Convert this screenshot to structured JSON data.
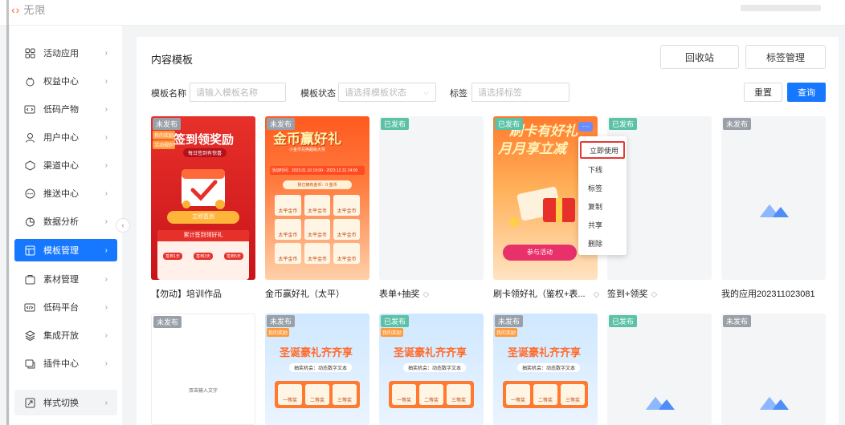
{
  "brand": {
    "mark": "‹›",
    "name": "无限"
  },
  "sidebar": {
    "items": [
      {
        "label": "活动应用",
        "icon": "apps-grid-icon"
      },
      {
        "label": "权益中心",
        "icon": "gift-icon"
      },
      {
        "label": "低码产物",
        "icon": "code-box-icon"
      },
      {
        "label": "用户中心",
        "icon": "user-icon"
      },
      {
        "label": "渠道中心",
        "icon": "channel-icon"
      },
      {
        "label": "推送中心",
        "icon": "push-icon"
      },
      {
        "label": "数据分析",
        "icon": "pie-chart-icon"
      },
      {
        "label": "模板管理",
        "icon": "template-icon",
        "active": true
      },
      {
        "label": "素材管理",
        "icon": "material-icon"
      },
      {
        "label": "低码平台",
        "icon": "lowcode-icon"
      },
      {
        "label": "集成开放",
        "icon": "layers-icon"
      },
      {
        "label": "插件中心",
        "icon": "plugin-icon"
      }
    ],
    "style_switch": "样式切换"
  },
  "main": {
    "title": "内容模板",
    "recycle_bin": "回收站",
    "tag_manage": "标签管理",
    "filters": {
      "name_label": "模板名称",
      "name_placeholder": "请输入模板名称",
      "status_label": "模板状态",
      "status_placeholder": "请选择模板状态",
      "tag_label": "标签",
      "tag_placeholder": "请选择标签",
      "reset": "重置",
      "query": "查询"
    }
  },
  "cards": [
    {
      "badge": "未发布",
      "name": "【勿动】培训作品",
      "poster": {
        "title": "签到领奖励",
        "subtitle": "每日签到有惊喜",
        "corner1": "我的奖励",
        "corner2": "活动规则",
        "button": "立即签到",
        "section": "累计签到领好礼",
        "steps": [
          "签到1天",
          "签到3天",
          "签到5天"
        ]
      }
    },
    {
      "badge": "未发布",
      "name": "金币赢好礼（太平）",
      "poster": {
        "title": "金币赢好礼",
        "subtitle": "小金币兑换超级大奖",
        "time": "活动时间：2023.01.10 10:00 - 2023.12.31 24:00",
        "coins": "我已拥有金币：0 金币",
        "cell": "太平金币"
      }
    },
    {
      "badge": "已发布",
      "name": "表单+抽奖",
      "tag": true
    },
    {
      "badge": "已发布",
      "name": "刷卡领好礼（鉴权+表...",
      "tag": true,
      "poster": {
        "title1": "刷卡有好礼",
        "title2": "月月享立减",
        "button": "参与活动"
      }
    },
    {
      "badge": "已发布",
      "name": "签到+领奖",
      "tag": true
    },
    {
      "badge": "未发布",
      "name": "我的应用202311023081"
    },
    {
      "badge": "未发布",
      "text": "双击输入文字"
    },
    {
      "badge": "未发布",
      "corner": "我的奖励",
      "poster": {
        "title": "圣诞豪礼齐齐享",
        "sub": "抽奖机会：动态数字文本",
        "cells": [
          "一等奖",
          "二等奖",
          "三等奖"
        ]
      }
    },
    {
      "badge": "已发布",
      "corner": "我的奖励",
      "poster": {
        "title": "圣诞豪礼齐齐享",
        "sub": "抽奖机会：动态数字文本",
        "cells": [
          "一等奖",
          "二等奖",
          "三等奖"
        ]
      }
    },
    {
      "badge": "未发布",
      "corner": "我的奖励",
      "poster": {
        "title": "圣诞豪礼齐齐享",
        "sub": "抽奖机会：动态数字文本",
        "cells": [
          "一等奖",
          "二等奖",
          "三等奖"
        ]
      }
    },
    {
      "badge": "已发布"
    },
    {
      "badge": "未发布"
    }
  ],
  "context_menu": {
    "more": "···",
    "items": [
      "立即使用",
      "下线",
      "标签",
      "复制",
      "共享",
      "删除"
    ]
  },
  "colors": {
    "accent": "#1677ff",
    "published": "#5cc2a6",
    "unpublished": "#9aa0a8",
    "highlight": "#e53935"
  }
}
